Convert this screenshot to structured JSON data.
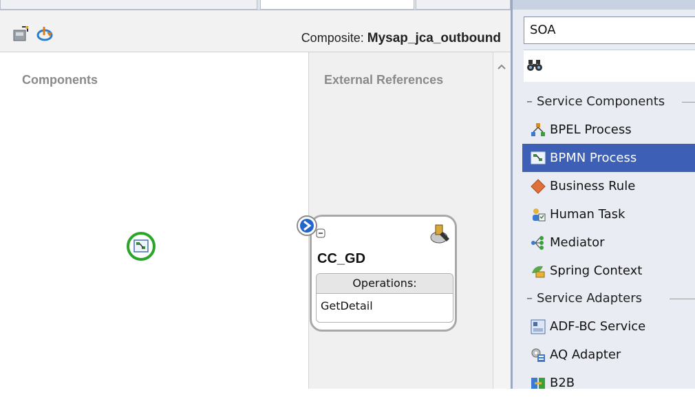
{
  "editor": {
    "composite_label": "Composite:",
    "composite_name": "Mysap_jca_outbound",
    "lanes": {
      "components_title": "Components",
      "external_title": "External References"
    },
    "reference": {
      "name": "CC_GD",
      "operations_header": "Operations:",
      "operations": [
        "GetDetail"
      ]
    }
  },
  "palette": {
    "selected_category": "SOA",
    "search_value": "",
    "sections": [
      {
        "title": "Service Components",
        "items": [
          {
            "label": "BPEL Process",
            "icon": "bpel-process-icon"
          },
          {
            "label": "BPMN Process",
            "icon": "bpmn-process-icon",
            "selected": true
          },
          {
            "label": "Business Rule",
            "icon": "business-rule-icon"
          },
          {
            "label": "Human Task",
            "icon": "human-task-icon"
          },
          {
            "label": "Mediator",
            "icon": "mediator-icon"
          },
          {
            "label": "Spring Context",
            "icon": "spring-context-icon"
          }
        ]
      },
      {
        "title": "Service Adapters",
        "items": [
          {
            "label": "ADF-BC Service",
            "icon": "adf-bc-service-icon"
          },
          {
            "label": "AQ Adapter",
            "icon": "aq-adapter-icon"
          },
          {
            "label": "B2B",
            "icon": "b2b-icon"
          }
        ]
      }
    ]
  },
  "colors": {
    "selection": "#3d5fb5",
    "drop_target_ring": "#2aa52a",
    "expand_arrow": "#2266cc"
  }
}
